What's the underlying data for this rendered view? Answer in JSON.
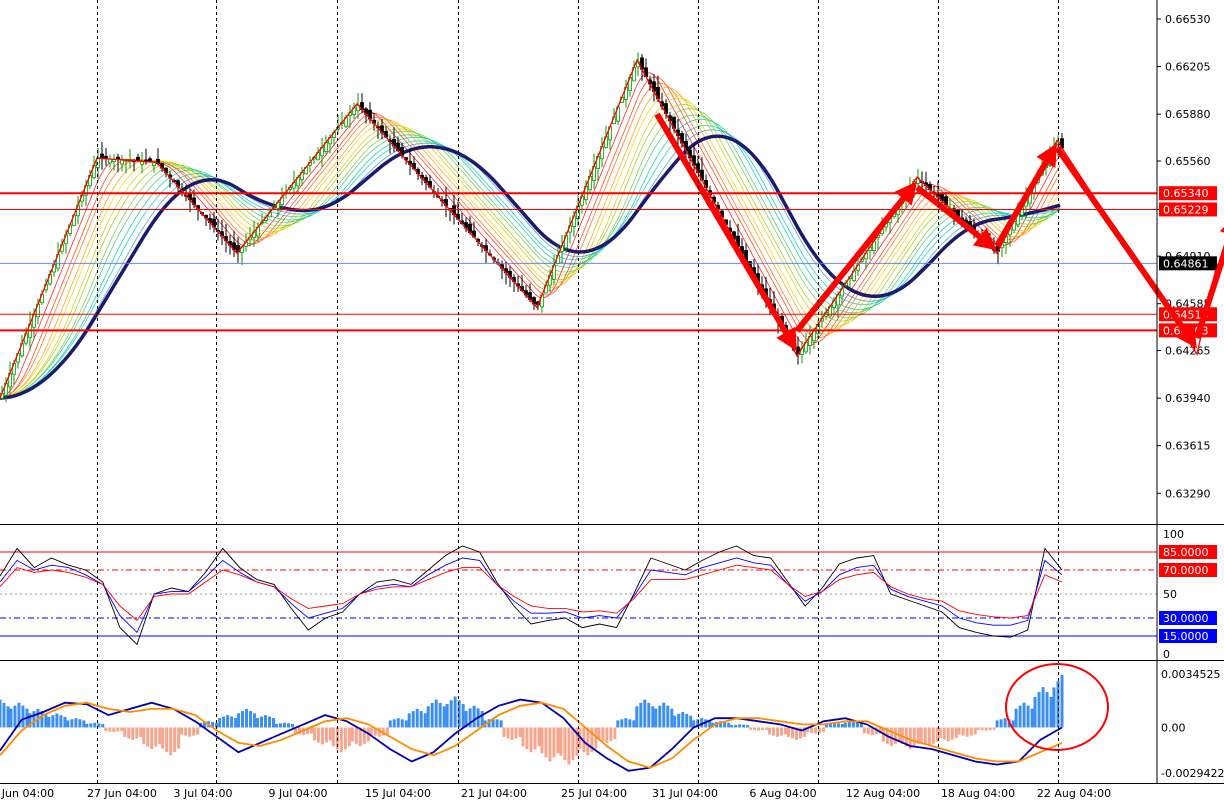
{
  "chart_data": [
    {
      "panel": "price",
      "type": "candlestick",
      "y_ticks": [
        "0.66530",
        "0.66205",
        "0.65880",
        "0.65560",
        "0.65229",
        "0.64910",
        "0.64585",
        "0.64265",
        "0.63940",
        "0.63615",
        "0.63290"
      ],
      "ylim": [
        0.6308,
        0.6666
      ],
      "current_price": "0.64861",
      "horizontal_lines": [
        {
          "label": "0.65340",
          "value": 0.6534,
          "color": "#ff0000"
        },
        {
          "label": "0.65229",
          "value": 0.65229,
          "color": "#ff0000"
        },
        {
          "label": "0.64513",
          "value": 0.64513,
          "color": "#ff0000"
        },
        {
          "label": "0.64403",
          "value": 0.64403,
          "color": "#ff0000"
        }
      ],
      "zigzag_points": [
        {
          "date": "before 27 Jun",
          "price": 0.6394
        },
        {
          "date": "27 Jun",
          "price": 0.6558
        },
        {
          "date": "30 Jun",
          "price": 0.6555
        },
        {
          "date": "4 Jul",
          "price": 0.6493
        },
        {
          "date": "10 Jul",
          "price": 0.6595
        },
        {
          "date": "15 Jul",
          "price": 0.6517
        },
        {
          "date": "19 Jul",
          "price": 0.6456
        },
        {
          "date": "24 Jul",
          "price": 0.6625
        },
        {
          "date": "1 Aug",
          "price": 0.6423
        },
        {
          "date": "7 Aug",
          "price": 0.6545
        },
        {
          "date": "11 Aug",
          "price": 0.6493
        },
        {
          "date": "14 Aug",
          "price": 0.657
        },
        {
          "date": "21 Aug",
          "price": 0.6424
        },
        {
          "date": "22 Aug",
          "price": 0.6486
        }
      ],
      "arrows": [
        {
          "from_date": "25 Jul",
          "from": 0.6588,
          "to_date": "1 Aug",
          "to": 0.6426,
          "direction": "down"
        },
        {
          "from_date": "1 Aug",
          "from": 0.644,
          "to_date": "7 Aug",
          "to": 0.6542,
          "direction": "up"
        },
        {
          "from_date": "7 Aug",
          "from": 0.6538,
          "to_date": "11 Aug",
          "to": 0.6495,
          "direction": "down"
        },
        {
          "from_date": "11 Aug",
          "from": 0.6498,
          "to_date": "14 Aug",
          "to": 0.6568,
          "direction": "up"
        },
        {
          "from_date": "14 Aug",
          "from": 0.6565,
          "to_date": "21 Aug",
          "to": 0.6428,
          "direction": "down"
        },
        {
          "from_date": "21 Aug",
          "from": 0.6435,
          "to_date": "23 Aug",
          "to": 0.652,
          "direction": "up"
        }
      ]
    },
    {
      "panel": "oscillator",
      "type": "line",
      "ylim": [
        0,
        100
      ],
      "y_ticks": [
        "100",
        "50",
        "0"
      ],
      "levels": [
        {
          "label": "85.0000",
          "value": 85,
          "color": "#ff0000"
        },
        {
          "label": "70.0000",
          "value": 70,
          "color": "#ff0000"
        },
        {
          "label": "30.0000",
          "value": 30,
          "color": "#0000ff"
        },
        {
          "label": "15.0000",
          "value": 15,
          "color": "#0000ff"
        }
      ],
      "series": [
        {
          "color": "#000000",
          "values": [
            65,
            88,
            72,
            80,
            74,
            70,
            60,
            22,
            8,
            50,
            55,
            52,
            68,
            88,
            72,
            62,
            58,
            38,
            20,
            30,
            35,
            50,
            60,
            62,
            58,
            70,
            82,
            90,
            85,
            60,
            40,
            25,
            28,
            30,
            22,
            25,
            22,
            50,
            80,
            75,
            70,
            78,
            85,
            90,
            82,
            80,
            60,
            40,
            55,
            75,
            80,
            82,
            50,
            45,
            40,
            35,
            22,
            18,
            15,
            14,
            20,
            88,
            70
          ]
        },
        {
          "color": "#0000ff",
          "values": [
            60,
            78,
            70,
            74,
            72,
            66,
            58,
            32,
            18,
            50,
            52,
            52,
            64,
            78,
            68,
            60,
            56,
            42,
            30,
            34,
            38,
            50,
            56,
            58,
            56,
            66,
            74,
            80,
            78,
            58,
            44,
            34,
            34,
            35,
            30,
            32,
            30,
            48,
            70,
            68,
            66,
            72,
            76,
            80,
            76,
            74,
            58,
            44,
            52,
            66,
            72,
            74,
            54,
            48,
            44,
            40,
            30,
            26,
            24,
            24,
            28,
            78,
            66
          ]
        },
        {
          "color": "#ff0000",
          "values": [
            56,
            72,
            68,
            70,
            68,
            64,
            58,
            40,
            28,
            48,
            50,
            50,
            60,
            70,
            66,
            60,
            56,
            46,
            38,
            40,
            42,
            50,
            54,
            56,
            56,
            62,
            68,
            72,
            72,
            58,
            48,
            40,
            38,
            38,
            35,
            36,
            34,
            46,
            62,
            62,
            62,
            66,
            70,
            74,
            72,
            70,
            58,
            48,
            52,
            62,
            66,
            68,
            56,
            50,
            46,
            44,
            36,
            33,
            31,
            30,
            32,
            66,
            60
          ]
        }
      ]
    },
    {
      "panel": "macd",
      "type": "bar",
      "y_ticks": [
        "0.0034525",
        "0.00",
        "-0.0029422"
      ],
      "ylim": [
        -0.0029422,
        0.0034525
      ],
      "histogram": [
        0.0018,
        0.0016,
        0.0012,
        0.0009,
        0.0006,
        0.0003,
        -0.0003,
        -0.0008,
        -0.0014,
        -0.0018,
        -0.0006,
        0.0004,
        0.0008,
        0.0012,
        0.0008,
        0.0003,
        -0.0005,
        -0.0011,
        -0.0016,
        -0.0012,
        -0.0006,
        0.0006,
        0.0012,
        0.0018,
        0.002,
        0.0014,
        0.0006,
        -0.0008,
        -0.0016,
        -0.0022,
        -0.0024,
        -0.0018,
        -0.001,
        0.0006,
        0.0018,
        0.0016,
        0.001,
        0.0006,
        0.0004,
        0.0002,
        -0.0002,
        -0.0006,
        -0.0008,
        -0.0004,
        0.0003,
        0.0004,
        -0.0005,
        -0.0012,
        -0.0014,
        -0.0012,
        -0.0009,
        -0.0006,
        -0.0002,
        0.0006,
        0.0016,
        0.0026,
        0.0034
      ],
      "series": [
        {
          "name": "",
          "color": "#0000aa",
          "values": [
            -0.0015,
            0.0005,
            0.001,
            0.0016,
            0.0015,
            0.0008,
            0.0012,
            0.0016,
            0.0012,
            0.0004,
            -0.0006,
            -0.0016,
            -0.001,
            -0.0004,
            0.0002,
            0.0008,
            0.0004,
            -0.0004,
            -0.0014,
            -0.0022,
            -0.0016,
            -0.0004,
            0.0006,
            0.0014,
            0.0018,
            0.0016,
            0.0006,
            -0.001,
            -0.002,
            -0.0028,
            -0.0026,
            -0.0014,
            0.0,
            0.0006,
            0.0006,
            0.0004,
            0.0002,
            -0.0002,
            0.0004,
            0.0006,
            0.0002,
            -0.0006,
            -0.0012,
            -0.0014,
            -0.0018,
            -0.0022,
            -0.0024,
            -0.0022,
            -0.0008,
            0.0
          ]
        },
        {
          "name": "",
          "color": "#ff8c00",
          "values": [
            -0.0018,
            -0.0002,
            0.0008,
            0.0014,
            0.0016,
            0.0012,
            0.001,
            0.0012,
            0.0012,
            0.0008,
            -0.0002,
            -0.001,
            -0.0012,
            -0.0008,
            -0.0002,
            0.0004,
            0.0006,
            0.0002,
            -0.0006,
            -0.0014,
            -0.0018,
            -0.0012,
            -0.0002,
            0.0008,
            0.0014,
            0.0016,
            0.0012,
            0.0,
            -0.0012,
            -0.0022,
            -0.0026,
            -0.002,
            -0.0008,
            0.0002,
            0.0006,
            0.0006,
            0.0004,
            0.0002,
            0.0002,
            0.0004,
            0.0004,
            -0.0002,
            -0.0008,
            -0.0012,
            -0.0016,
            -0.002,
            -0.0022,
            -0.0022,
            -0.0016,
            -0.001
          ]
        }
      ]
    }
  ],
  "x_axis": {
    "labels": [
      "Jun 04:00",
      "27 Jun 04:00",
      "3 Jul 04:00",
      "9 Jul 04:00",
      "15 Jul 04:00",
      "21 Jul 04:00",
      "25 Jul 04:00",
      "31 Jul 04:00",
      "6 Aug 04:00",
      "12 Aug 04:00",
      "18 Aug 04:00",
      "22 Aug 04:00"
    ]
  },
  "colors": {
    "red": "#ff0000",
    "blue": "#0000ff",
    "navy": "#1a1a6e",
    "up_hist": "#3c8ff0",
    "down_hist": "#f7a58c",
    "orange": "#ff8c00"
  }
}
